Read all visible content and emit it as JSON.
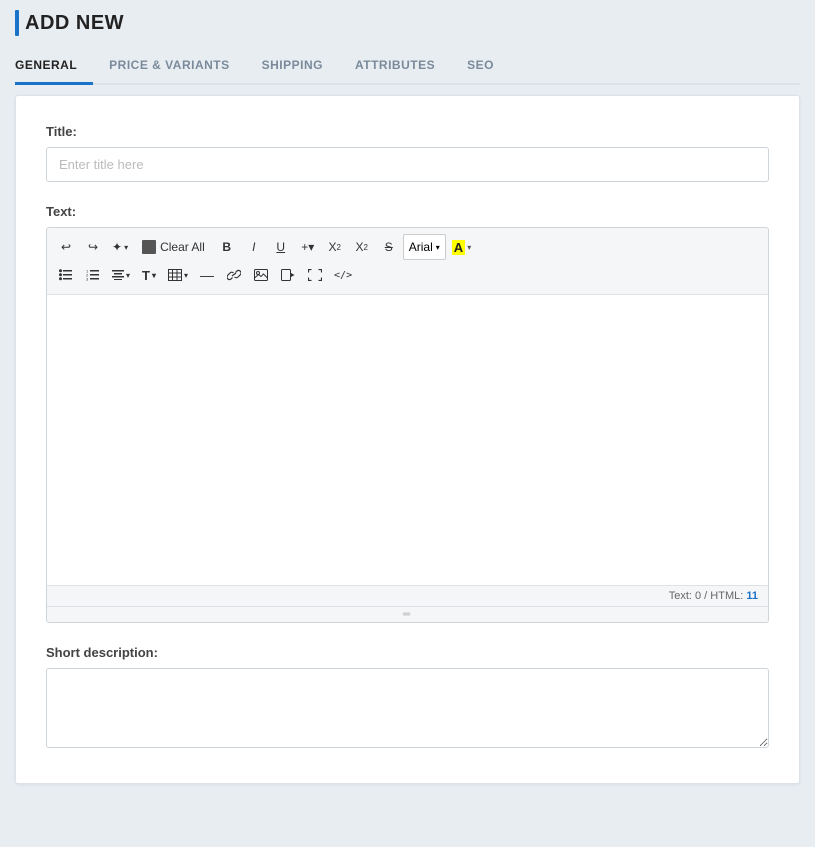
{
  "page": {
    "title": "ADD NEW",
    "accent_color": "#1a73c8"
  },
  "tabs": [
    {
      "id": "general",
      "label": "GENERAL",
      "active": true
    },
    {
      "id": "price-variants",
      "label": "PRICE & VARIANTS",
      "active": false
    },
    {
      "id": "shipping",
      "label": "SHIPPING",
      "active": false
    },
    {
      "id": "attributes",
      "label": "ATTRIBUTES",
      "active": false
    },
    {
      "id": "seo",
      "label": "SEO",
      "active": false
    }
  ],
  "form": {
    "title_label": "Title:",
    "title_placeholder": "Enter title here",
    "text_label": "Text:",
    "short_description_label": "Short description:",
    "editor": {
      "statusbar_text": "Text: 0 / HTML: ",
      "html_count": "11"
    },
    "toolbar": {
      "undo": "↩",
      "redo": "↪",
      "magic": "✦",
      "magic_more_arrow": "▾",
      "clear_icon": "■",
      "clear_all_label": "Clear All",
      "bold_label": "B",
      "italic_label": "I",
      "underline_label": "U",
      "insert_arrow": "+▾",
      "superscript_label": "X²",
      "subscript_label": "X₂",
      "strikethrough_label": "S",
      "font_label": "Arial",
      "font_arrow": "▾",
      "highlight_label": "A",
      "highlight_arrow": "▾",
      "ul_label": "☰",
      "ol_label": "≡",
      "align_label": "≡",
      "align_arrow": "▾",
      "para_label": "T",
      "para_arrow": "▾",
      "table_label": "⊞",
      "table_arrow": "▾",
      "hr_label": "—",
      "link_label": "🔗",
      "image_label": "🖼",
      "video_label": "▶",
      "fullscreen_label": "⤢",
      "source_label": "</>"
    }
  }
}
